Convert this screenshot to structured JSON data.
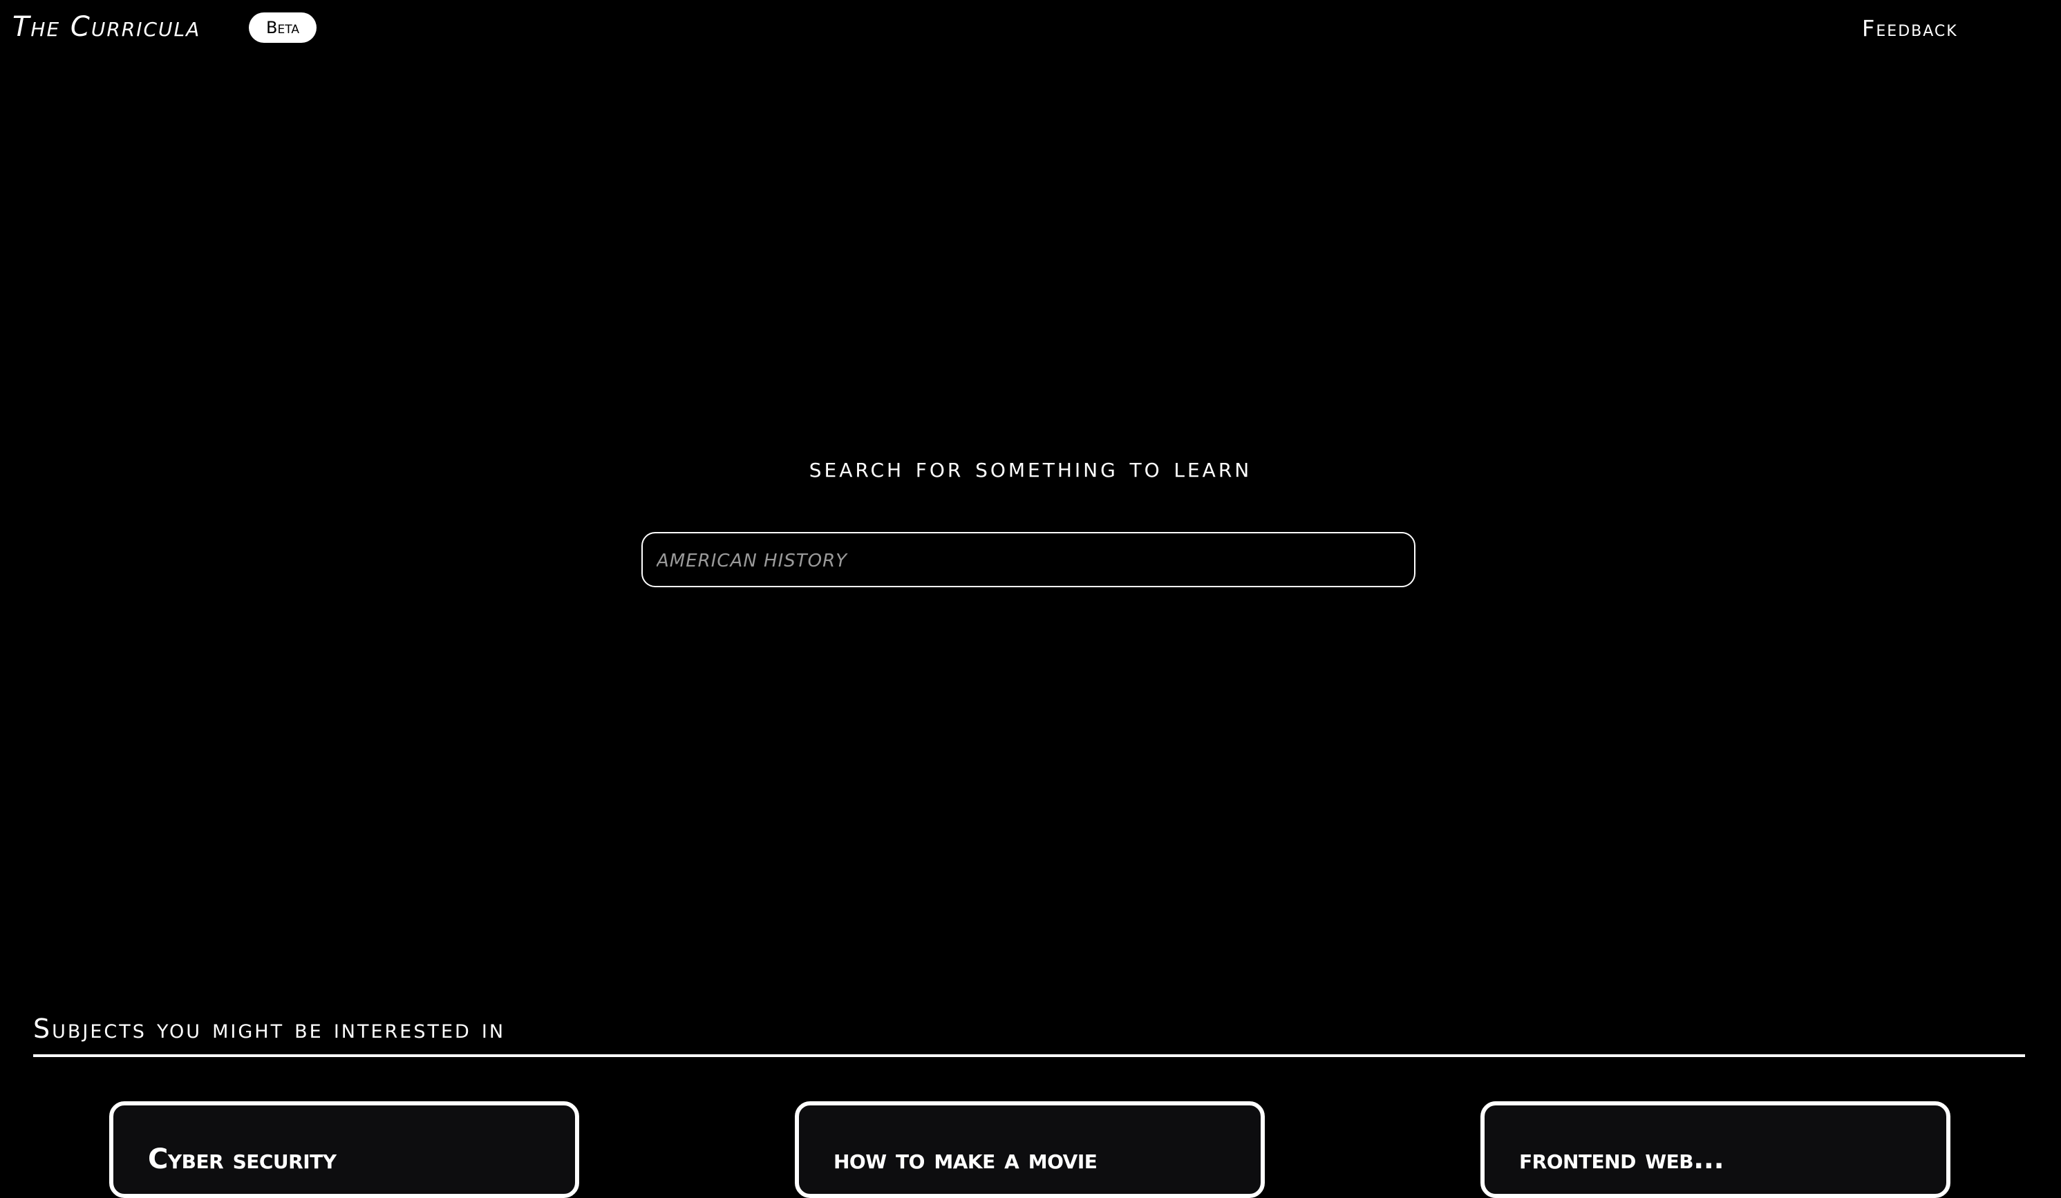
{
  "header": {
    "brand": "The Curricula",
    "badge": "Beta",
    "feedback_label": "Feedback"
  },
  "hero": {
    "title": "search for something to learn",
    "search_placeholder": "AMERICAN HISTORY"
  },
  "subjects": {
    "title": "Subjects you might be interested in",
    "items": [
      {
        "label": "Cyber security"
      },
      {
        "label": "how to make a movie"
      },
      {
        "label": "frontend web..."
      }
    ]
  },
  "colors": {
    "background": "#000000",
    "foreground": "#ffffff",
    "placeholder": "#9a9a9a",
    "card_background": "#0d0d0f"
  }
}
